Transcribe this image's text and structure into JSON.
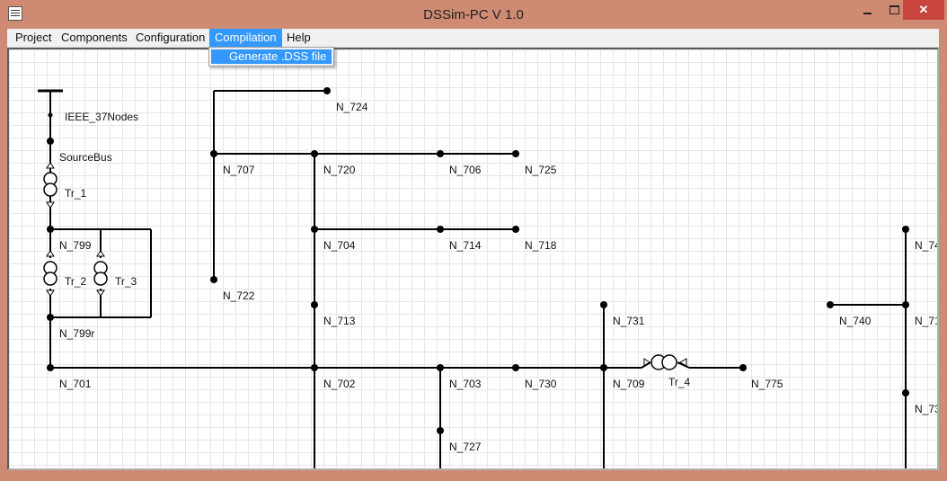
{
  "window": {
    "title": "DSSim-PC V 1.0",
    "close_glyph": "✕"
  },
  "menu": {
    "items": [
      "Project",
      "Components",
      "Configuration",
      "Compilation",
      "Help"
    ],
    "active": "Compilation"
  },
  "dropdown": {
    "items": [
      "Generate .DSS file"
    ]
  },
  "diagram": {
    "source": "IEEE_37Nodes",
    "nodes": {
      "sourcebus": "SourceBus",
      "n799": "N_799",
      "n799r": "N_799r",
      "n701": "N_701",
      "n724": "N_724",
      "n707": "N_707",
      "n722": "N_722",
      "n720": "N_720",
      "n706": "N_706",
      "n725": "N_725",
      "n704": "N_704",
      "n714": "N_714",
      "n718": "N_718",
      "n713": "N_713",
      "n702": "N_702",
      "n703": "N_703",
      "n727": "N_727",
      "n730": "N_730",
      "n731": "N_731",
      "n709": "N_709",
      "n775": "N_775",
      "n740": "N_740",
      "n74x": "N_74",
      "n71x": "N_71",
      "n73x": "N_73"
    },
    "transformers": {
      "tr1": "Tr_1",
      "tr2": "Tr_2",
      "tr3": "Tr_3",
      "tr4": "Tr_4"
    }
  }
}
